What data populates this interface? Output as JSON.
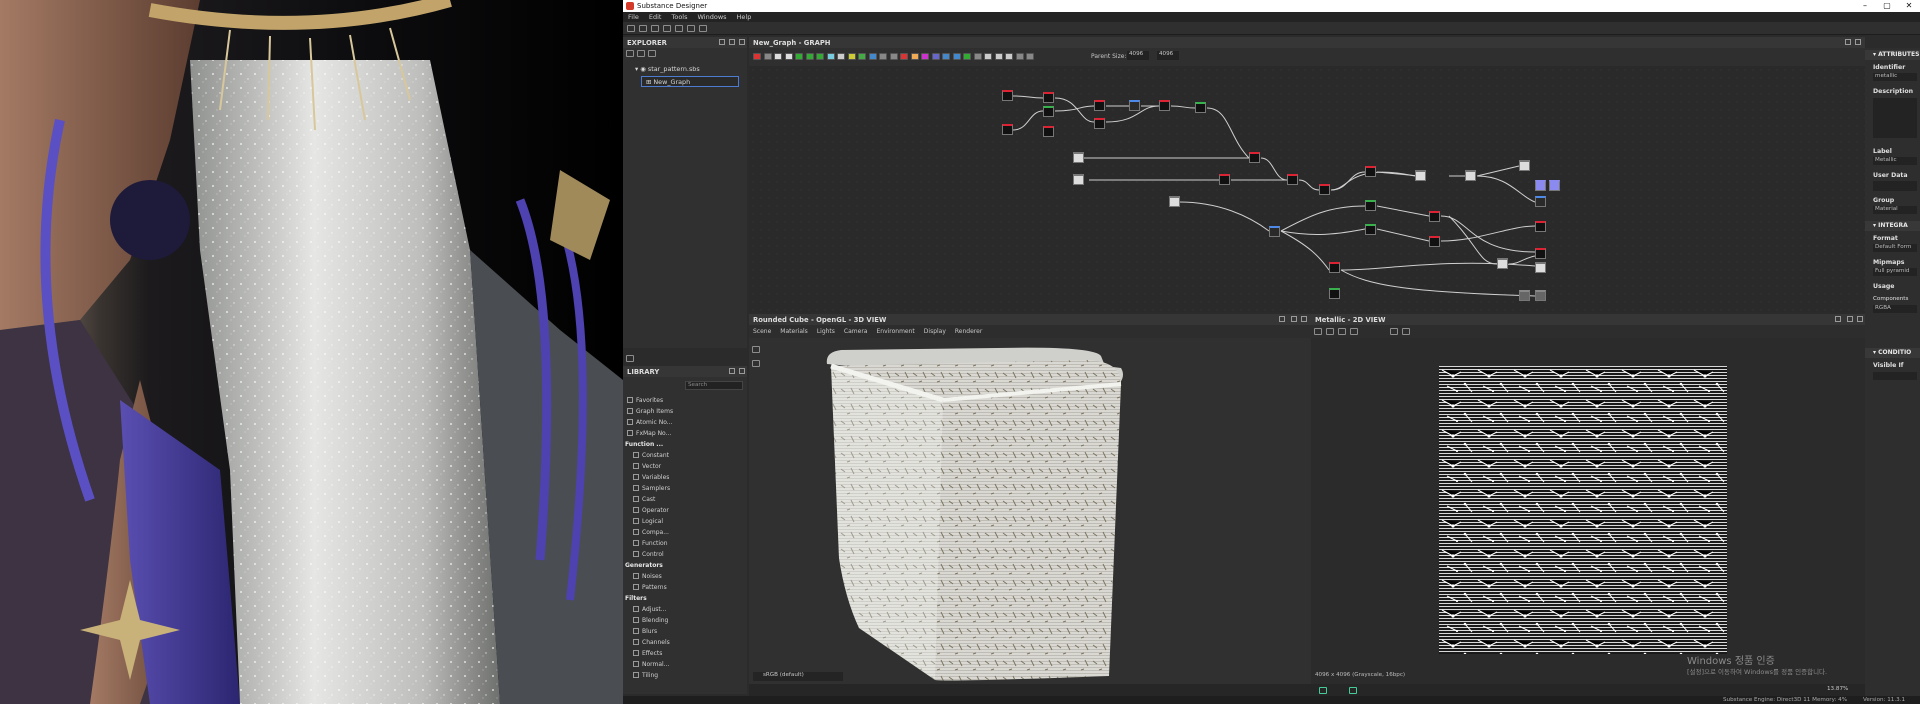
{
  "window": {
    "title": "Substance Designer",
    "controls": [
      "–",
      "▢",
      "✕"
    ]
  },
  "menu": [
    "File",
    "Edit",
    "Tools",
    "Windows",
    "Help"
  ],
  "explorer": {
    "title": "EXPLORER",
    "package": "star_pattern.sbs",
    "graph": "New_Graph"
  },
  "library": {
    "title": "LIBRARY",
    "search_placeholder": "Search",
    "items": [
      {
        "label": "Favorites",
        "kind": "item"
      },
      {
        "label": "Graph Items",
        "kind": "item"
      },
      {
        "label": "Atomic No...",
        "kind": "item"
      },
      {
        "label": "FxMap No...",
        "kind": "item"
      },
      {
        "label": "Function ...",
        "kind": "cat"
      },
      {
        "label": "Constant",
        "kind": "item"
      },
      {
        "label": "Vector",
        "kind": "item"
      },
      {
        "label": "Variables",
        "kind": "item"
      },
      {
        "label": "Samplers",
        "kind": "item"
      },
      {
        "label": "Cast",
        "kind": "item"
      },
      {
        "label": "Operator",
        "kind": "item"
      },
      {
        "label": "Logical",
        "kind": "item"
      },
      {
        "label": "Compa...",
        "kind": "item"
      },
      {
        "label": "Function",
        "kind": "item"
      },
      {
        "label": "Control",
        "kind": "item"
      },
      {
        "label": "Generators",
        "kind": "cat"
      },
      {
        "label": "Noises",
        "kind": "item"
      },
      {
        "label": "Patterns",
        "kind": "item"
      },
      {
        "label": "Filters",
        "kind": "cat"
      },
      {
        "label": "Adjust...",
        "kind": "item"
      },
      {
        "label": "Blending",
        "kind": "item"
      },
      {
        "label": "Blurs",
        "kind": "item"
      },
      {
        "label": "Channels",
        "kind": "item"
      },
      {
        "label": "Effects",
        "kind": "item"
      },
      {
        "label": "Normal...",
        "kind": "item"
      },
      {
        "label": "Tiling",
        "kind": "item"
      }
    ]
  },
  "graph": {
    "title": "New_Graph - GRAPH",
    "parent_size_label": "Parent Size:",
    "width": "4096",
    "height": "4096"
  },
  "view3d": {
    "title": "Rounded Cube - OpenGL - 3D VIEW",
    "tabs": [
      "Scene",
      "Materials",
      "Lights",
      "Camera",
      "Environment",
      "Display",
      "Renderer"
    ],
    "colorspace": "sRGB (default)"
  },
  "view2d": {
    "title": "Metallic - 2D VIEW",
    "info": "4096 x 4096 (Grayscale, 16bpc)",
    "zoom": "13.87%"
  },
  "attributes": {
    "title": "ATTRIBUTES",
    "identifier_label": "Identifier",
    "identifier_value": "metallic",
    "description_label": "Description",
    "label_label": "Label",
    "label_value": "Metallic",
    "userdata_label": "User Data",
    "group_label": "Group",
    "group_value": "Material",
    "integration_label": "INTEGRA",
    "format_label": "Format",
    "format_value": "Default Form",
    "mipmaps_label": "Mipmaps",
    "mipmaps_value": "Full pyramid",
    "usage_label": "Usage",
    "component_label": "Components",
    "component_value": "RGBA",
    "conditions_label": "CONDITIO",
    "visible_label": "Visible If"
  },
  "watermark": {
    "line1": "Windows 정품 인증",
    "line2": "[설정]으로 이동하여 Windows를 정품 인증합니다."
  },
  "status": {
    "engine": "Substance Engine: Direct3D 11  Memory: 4%",
    "version": "Version: 11.3.1"
  }
}
